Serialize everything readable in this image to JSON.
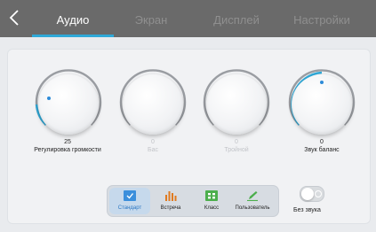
{
  "tabs": [
    {
      "label": "Аудио",
      "active": true
    },
    {
      "label": "Экран",
      "active": false
    },
    {
      "label": "Дисплей",
      "active": false
    },
    {
      "label": "Настройки",
      "active": false
    }
  ],
  "knobs": [
    {
      "value": "25",
      "label": "Регулировка громкости",
      "enabled": true
    },
    {
      "value": "0",
      "label": "Бас",
      "enabled": false
    },
    {
      "value": "0",
      "label": "Тройной",
      "enabled": false
    },
    {
      "value": "0",
      "label": "Звук баланс",
      "enabled": true
    }
  ],
  "modes": [
    {
      "label": "Стандарт",
      "icon": "standard-mode-icon",
      "active": true
    },
    {
      "label": "Встреча",
      "icon": "meeting-bars-icon",
      "active": false
    },
    {
      "label": "Класс",
      "icon": "class-grid-icon",
      "active": false
    },
    {
      "label": "Пользователь",
      "icon": "user-pencil-icon",
      "active": false
    }
  ],
  "mute": {
    "label": "Без звука",
    "on": false
  },
  "colors": {
    "accent": "#2fa9d8",
    "topbar": "#6a6a6a",
    "meeting": "#e07a1f",
    "class": "#4cae4c"
  }
}
